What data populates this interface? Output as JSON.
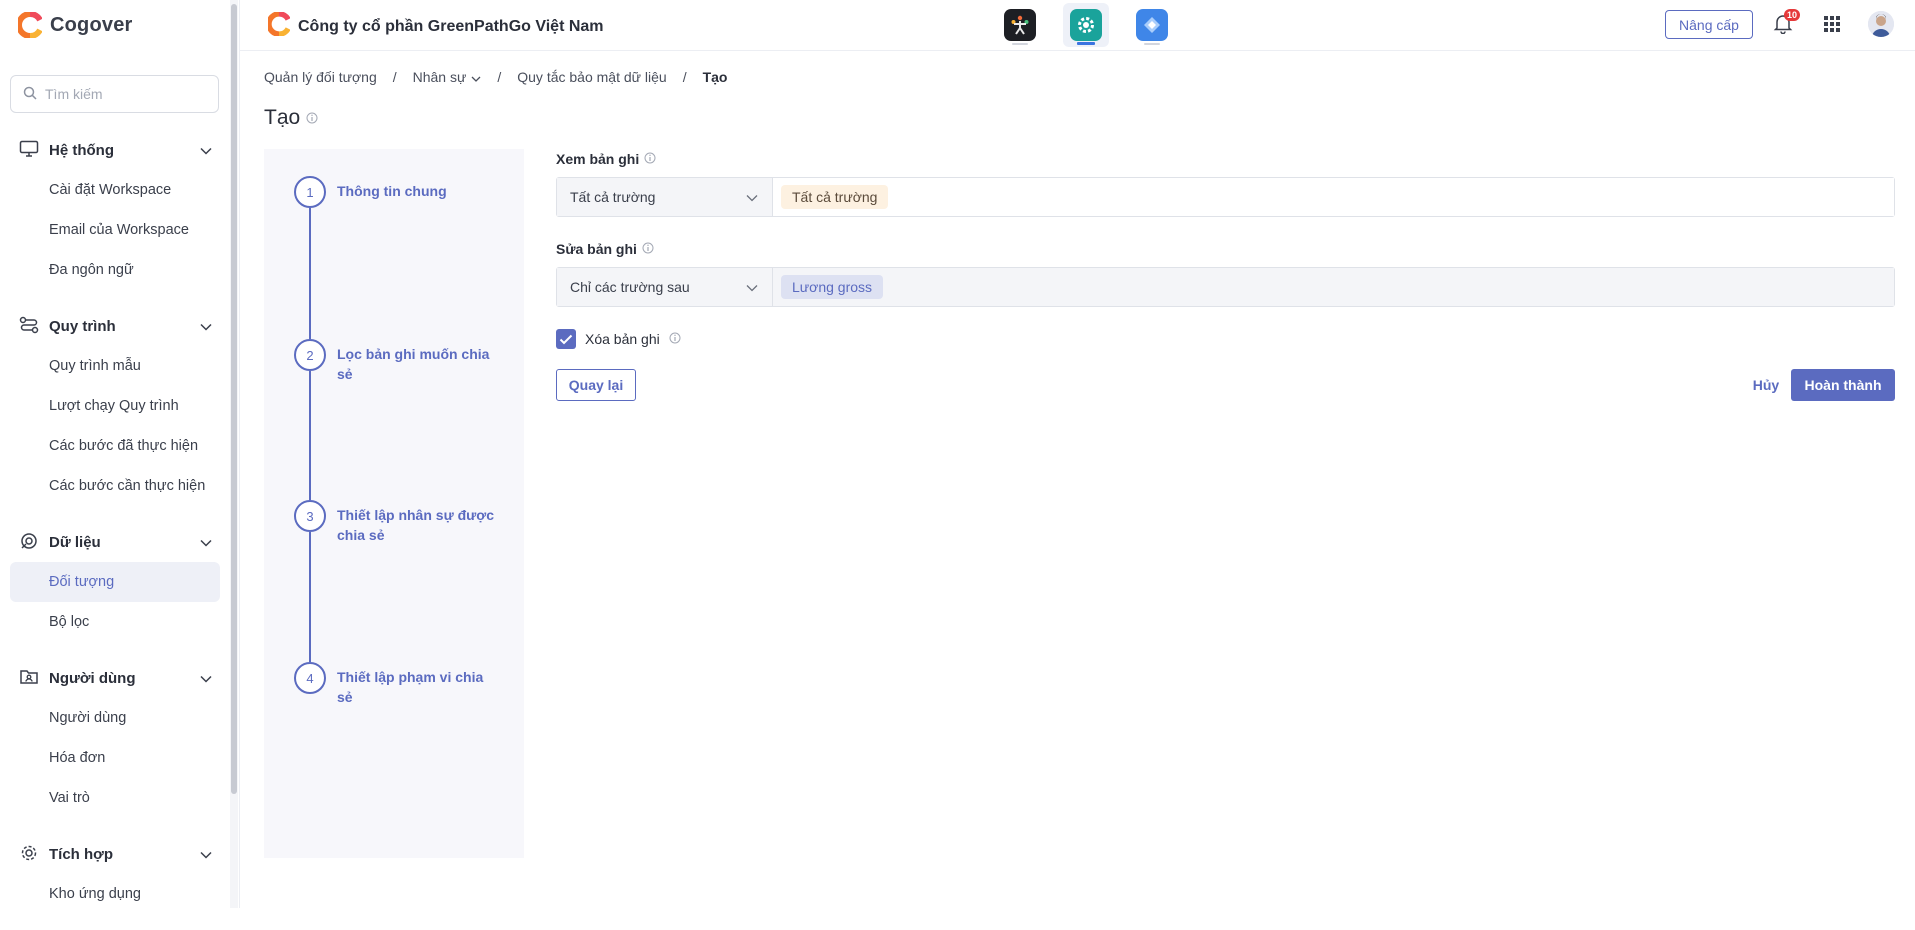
{
  "app": {
    "name": "Cogover",
    "company": "Công ty cổ phần GreenPathGo Việt Nam",
    "brand_color": "#5b6bc0"
  },
  "search": {
    "placeholder": "Tìm kiếm"
  },
  "sidebar": {
    "groups": [
      {
        "label": "Hệ thống",
        "icon": "monitor-icon",
        "items": [
          "Cài đặt Workspace",
          "Email của Workspace",
          "Đa ngôn ngữ"
        ]
      },
      {
        "label": "Quy trình",
        "icon": "workflow-icon",
        "items": [
          "Quy trình mẫu",
          "Lượt chạy Quy trình",
          "Các bước đã thực hiện",
          "Các bước cần thực hiện"
        ]
      },
      {
        "label": "Dữ liệu",
        "icon": "data-icon",
        "items": [
          "Đối tượng",
          "Bộ lọc"
        ]
      },
      {
        "label": "Người dùng",
        "icon": "users-folder-icon",
        "items": [
          "Người dùng",
          "Hóa đơn",
          "Vai trò"
        ]
      },
      {
        "label": "Tích hợp",
        "icon": "integration-gear-icon",
        "items": [
          "Kho ứng dụng"
        ]
      }
    ],
    "active_item": "Đối tượng"
  },
  "topbar": {
    "apps": [
      "people-app-icon",
      "settings-app-icon",
      "diamond-app-icon"
    ],
    "upgrade_label": "Nâng cấp",
    "notification_count": "10"
  },
  "breadcrumb": {
    "items": [
      "Quản lý đối tượng",
      "Nhân sự",
      "Quy tắc bảo mật dữ liệu"
    ],
    "current": "Tạo"
  },
  "page": {
    "title": "Tạo"
  },
  "steps": [
    {
      "num": "1",
      "label": "Thông tin chung"
    },
    {
      "num": "2",
      "label": "Lọc bản ghi muốn chia sẻ"
    },
    {
      "num": "3",
      "label": "Thiết lập nhân sự được chia sẻ"
    },
    {
      "num": "4",
      "label": "Thiết lập phạm vi chia sẻ"
    }
  ],
  "form": {
    "view": {
      "label": "Xem bản ghi",
      "select_value": "Tất cả trường",
      "tag": "Tất cả trường"
    },
    "edit": {
      "label": "Sửa bản ghi",
      "select_value": "Chỉ các trường sau",
      "tag": "Lương gross"
    },
    "delete": {
      "label": "Xóa bản ghi",
      "checked": true
    }
  },
  "actions": {
    "back_label": "Quay lại",
    "cancel_label": "Hủy",
    "done_label": "Hoàn thành"
  }
}
